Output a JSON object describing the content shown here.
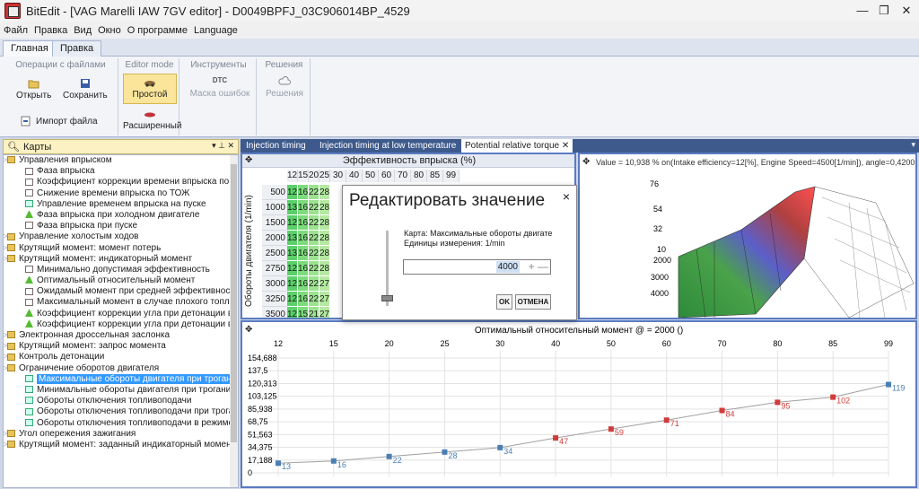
{
  "window": {
    "title": "BitEdit - [VAG Marelli IAW 7GV editor] - D0049BPFJ_03C906014BP_4529"
  },
  "menu": [
    "Файл",
    "Правка",
    "Вид",
    "Окно",
    "О программе",
    "Language"
  ],
  "ribbon": {
    "tabs": [
      "Главная",
      "Правка"
    ],
    "groups": {
      "file": {
        "title": "Операции с файлами",
        "open": "Открыть",
        "save": "Сохранить",
        "import": "Импорт файла"
      },
      "editor": {
        "title": "Editor mode",
        "simple": "Простой",
        "advanced": "Расширенный"
      },
      "tools": {
        "title": "Инструменты",
        "dtc_icon": "DTC",
        "errors": "Маска ошибок"
      },
      "solutions": {
        "title": "Решения",
        "solutions": "Решения"
      }
    }
  },
  "left_panel": {
    "title": "Карты",
    "items": [
      {
        "label": "Управления впрыском",
        "level": 0,
        "icon": "folder-icon"
      },
      {
        "label": "Фаза впрыска",
        "level": 1,
        "icon": "map-icon"
      },
      {
        "label": "Коэффициент коррекции времени впрыска по ТОЖ",
        "level": 1,
        "icon": "map-icon"
      },
      {
        "label": "Снижение времени впрыска по ТОЖ",
        "level": 1,
        "icon": "map-icon"
      },
      {
        "label": "Управление временем впрыска на пуске",
        "level": 1,
        "icon": "table-icon"
      },
      {
        "label": "Фаза впрыска при холодном двигателе",
        "level": 1,
        "icon": "graph-icon"
      },
      {
        "label": "Фаза впрыска при пуске",
        "level": 1,
        "icon": "map-icon"
      },
      {
        "label": "Управление холостым ходов",
        "level": 0,
        "icon": "folder-icon"
      },
      {
        "label": "Крутящий момент: момент потерь",
        "level": 0,
        "icon": "folder-icon"
      },
      {
        "label": "Крутящий момент: индикаторный момент",
        "level": 0,
        "icon": "folder-icon"
      },
      {
        "label": "Минимально допустимая эффективность",
        "level": 1,
        "icon": "map-icon"
      },
      {
        "label": "Оптимальный относительный момент",
        "level": 1,
        "icon": "graph-icon"
      },
      {
        "label": "Ожидамый момент при средней эффективности",
        "level": 1,
        "icon": "map-icon"
      },
      {
        "label": "Максимальный момент в случае плохого топлива",
        "level": 1,
        "icon": "map-icon"
      },
      {
        "label": "Коэффициент коррекции угла при детонации в слу",
        "level": 1,
        "icon": "graph-icon"
      },
      {
        "label": "Коэффициент коррекции угла при детонации в слу",
        "level": 1,
        "icon": "graph-icon"
      },
      {
        "label": "Электронная дроссельная заслонка",
        "level": 0,
        "icon": "folder-icon"
      },
      {
        "label": "Крутящий момент: запрос момента",
        "level": 0,
        "icon": "folder-icon"
      },
      {
        "label": "Контроль детонации",
        "level": 0,
        "icon": "folder-icon"
      },
      {
        "label": "Ограничение оборотов двигателя",
        "level": 0,
        "icon": "folder-icon"
      },
      {
        "label": "Максимальные обороты двигателя при трогании",
        "level": 1,
        "icon": "table-icon",
        "selected": true
      },
      {
        "label": "Минимальные обороты двигателя при трогании",
        "level": 1,
        "icon": "table-icon"
      },
      {
        "label": "Обороты отключения топливоподачи",
        "level": 1,
        "icon": "table-icon"
      },
      {
        "label": "Обороты отключения топливоподачи при трогани",
        "level": 1,
        "icon": "table-icon"
      },
      {
        "label": "Обороты отключения топливоподачи в режиме вс",
        "level": 1,
        "icon": "table-icon"
      },
      {
        "label": "Угол опережения зажигания",
        "level": 0,
        "icon": "folder-icon"
      },
      {
        "label": "Крутящий момент: заданный индикаторный момент",
        "level": 0,
        "icon": "folder-icon"
      }
    ]
  },
  "doc_tabs": [
    "Injection timing",
    "Injection timing at low temperature",
    "Potential relative torque"
  ],
  "table": {
    "title": "Эффективность впрыска (%)",
    "y_label": "Обороты двигателя (1/min)",
    "columns": [
      "12",
      "15",
      "20",
      "25",
      "30",
      "40",
      "50",
      "60",
      "70",
      "80",
      "85",
      "99"
    ],
    "rows": [
      "500",
      "1000",
      "1500",
      "2000",
      "2500",
      "2750",
      "3000",
      "3250",
      "3500"
    ],
    "cells": [
      [
        "12",
        "16",
        "22",
        "28"
      ],
      [
        "13",
        "16",
        "22",
        "28"
      ],
      [
        "12",
        "16",
        "22",
        "28"
      ],
      [
        "13",
        "16",
        "22",
        "28"
      ],
      [
        "13",
        "16",
        "22",
        "28"
      ],
      [
        "12",
        "16",
        "22",
        "28"
      ],
      [
        "12",
        "16",
        "22",
        "27"
      ],
      [
        "12",
        "16",
        "22",
        "27"
      ],
      [
        "12",
        "15",
        "21",
        "27"
      ]
    ]
  },
  "graph3d": {
    "info": "Value = 10,938 % on(Intake efficiency=12[%], Engine Speed=4500[1/min]), angle=0,4200",
    "ticks": [
      "76",
      "54",
      "32",
      "10",
      "2000",
      "3000",
      "4000"
    ]
  },
  "dialog": {
    "title": "Редактировать значение",
    "close": "×",
    "map_line": "Карта: Максимальные обороты двигате",
    "unit_line": "Единицы измерения: 1/min",
    "value": "4000",
    "pm": "+ —",
    "ok": "OK",
    "cancel": "ОТМЕНА"
  },
  "chart_data": {
    "type": "line",
    "title": "Оптимальный относительный момент @  = 2000 ()",
    "categories": [
      "12",
      "15",
      "20",
      "25",
      "30",
      "40",
      "50",
      "60",
      "70",
      "80",
      "85",
      "99"
    ],
    "values": [
      13,
      16,
      22,
      28,
      34,
      47,
      59,
      71,
      84,
      95,
      102,
      119
    ],
    "yticks": [
      "154,688",
      "137,5",
      "120,313",
      "103,125",
      "85,938",
      "68,75",
      "51,563",
      "34,375",
      "17,188",
      "0"
    ],
    "ylim": [
      0,
      154.688
    ],
    "colors": {
      "low": "#4a7fb5",
      "high": "#d23b3b",
      "line": "#a0a0a0"
    }
  }
}
